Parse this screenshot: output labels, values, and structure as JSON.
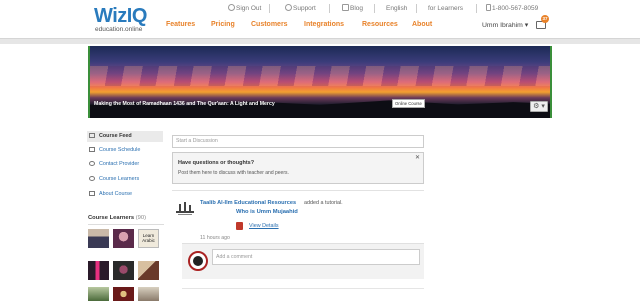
{
  "header": {
    "logo_main": "WizIQ",
    "logo_sub": "education.online",
    "top_links": {
      "sign_out": "Sign Out",
      "support": "Support",
      "blog": "Blog",
      "language": "English",
      "for_learners": "for Learners",
      "phone": "1-800-567-8059"
    },
    "nav": [
      "Features",
      "Pricing",
      "Customers",
      "Integrations",
      "Resources",
      "About"
    ],
    "user_name": "Umm Ibrahim",
    "user_caret": "▾",
    "message_count": "37"
  },
  "banner": {
    "course_title": "Making the Most of Ramadhaan 1436 and The Qur'aan: A Light and Mercy",
    "badge": "Online Course",
    "gear_label": "⚙ ▾"
  },
  "sidebar": {
    "items": [
      {
        "label": "Course Feed",
        "icon": "feed-icon",
        "active": true
      },
      {
        "label": "Course Schedule",
        "icon": "calendar-icon",
        "active": false
      },
      {
        "label": "Contact Provider",
        "icon": "person-icon",
        "active": false
      },
      {
        "label": "Course Learners",
        "icon": "group-icon",
        "active": false
      },
      {
        "label": "About Course",
        "icon": "document-icon",
        "active": false
      }
    ],
    "learners_title": "Course Learners",
    "learners_count": "(90)",
    "learner_thumbs": [
      {
        "name": "learner-thumb-1",
        "colors": [
          "#3a3a55",
          "#c9b9a8"
        ]
      },
      {
        "name": "learner-thumb-2",
        "colors": [
          "#5a2a4a",
          "#d8a0b0"
        ]
      },
      {
        "name": "learner-thumb-3",
        "colors": [
          "#f0eadc",
          "#222"
        ],
        "text": "Learn Arabic"
      },
      {
        "name": "learner-thumb-4",
        "colors": [
          "#e83080",
          "#2a1a2a"
        ]
      },
      {
        "name": "learner-thumb-5",
        "colors": [
          "#2a2a2a",
          "#9a4a6a"
        ]
      },
      {
        "name": "learner-thumb-6",
        "colors": [
          "#6a3a2a",
          "#d8c0a0"
        ]
      },
      {
        "name": "learner-thumb-7",
        "colors": [
          "#4a6a3a",
          "#b8c8a0"
        ]
      },
      {
        "name": "learner-thumb-8",
        "colors": [
          "#6a1a1a",
          "#e0c080"
        ]
      },
      {
        "name": "learner-thumb-9",
        "colors": [
          "#d8d0c0",
          "#8a7a6a"
        ]
      }
    ]
  },
  "feed": {
    "start_placeholder": "Start a Discussion",
    "prompt_title": "Have questions or thoughts?",
    "prompt_body": "Post them here to discuss with teacher and peers.",
    "close_glyph": "✕",
    "post": {
      "author": "Taalib Al-Ilm Educational Resources",
      "action": "added a tutorial.",
      "target": "Who is Umm Mujaahid",
      "file_icon": "pdf-icon",
      "view_details": "View Details",
      "time": "11 hours ago"
    },
    "comment_placeholder": "Add a comment"
  },
  "colors": {
    "brand_blue": "#2a7bbd",
    "nav_orange": "#e8822a",
    "link_blue": "#2a6fb0",
    "banner_border": "#3a8f3a"
  }
}
